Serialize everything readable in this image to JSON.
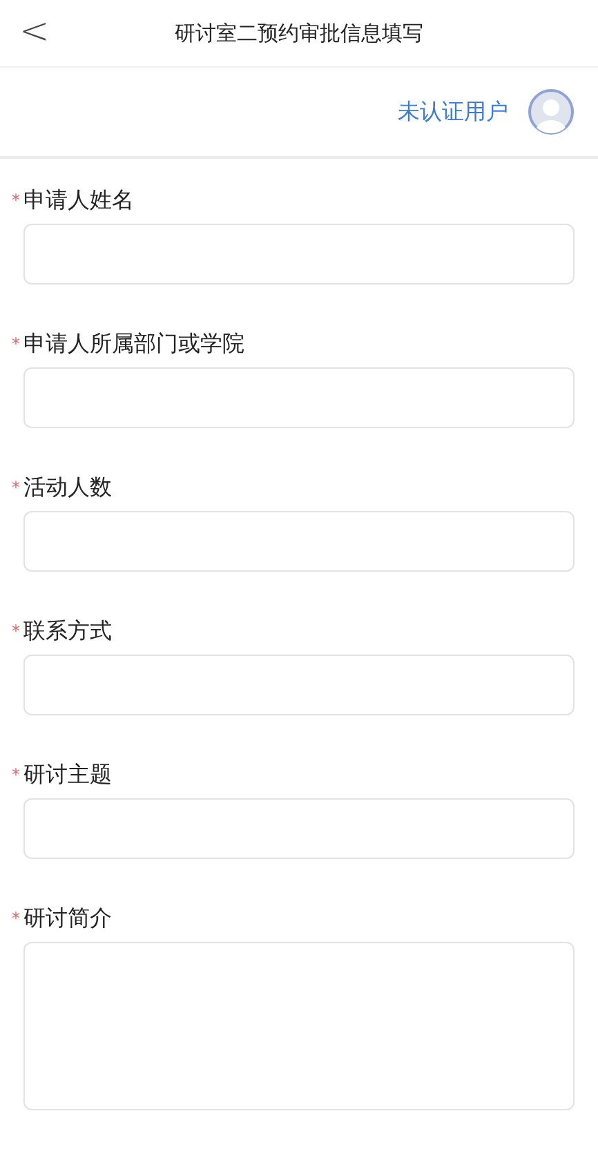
{
  "header": {
    "back": "<",
    "title": "研讨室二预约审批信息填写"
  },
  "user": {
    "name": "未认证用户"
  },
  "fields": [
    {
      "mark": "*",
      "label": "申请人姓名",
      "kind": "input"
    },
    {
      "mark": "*",
      "label": "申请人所属部门或学院",
      "kind": "input"
    },
    {
      "mark": "*",
      "label": "活动人数",
      "kind": "input"
    },
    {
      "mark": "*",
      "label": "联系方式",
      "kind": "input"
    },
    {
      "mark": "*",
      "label": "研讨主题",
      "kind": "input"
    },
    {
      "mark": "*",
      "label": "研讨简介",
      "kind": "textarea"
    }
  ]
}
